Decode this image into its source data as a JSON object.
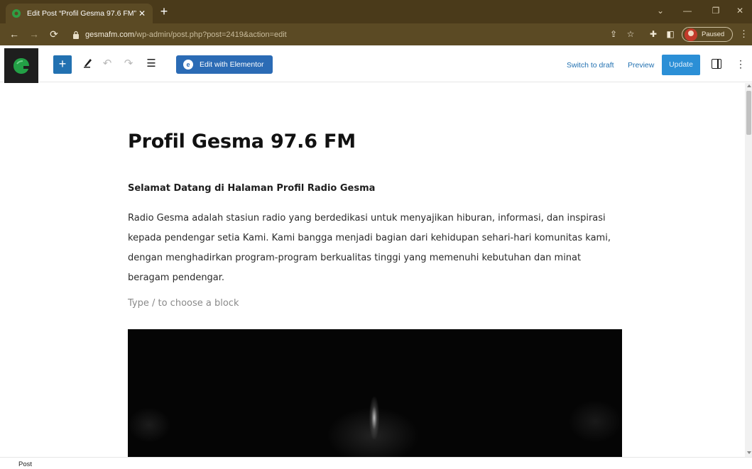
{
  "browser": {
    "tab": {
      "title": "Edit Post “Profil Gesma 97.6 FM”",
      "favicon": "gesma-favicon-icon"
    },
    "new_tab_label": "+",
    "url": {
      "host": "gesmafm.com",
      "path": "/wp-admin/post.php?post=2419&action=edit"
    },
    "profile": {
      "status": "Paused"
    },
    "window_controls": [
      "minimize-chevron",
      "minimize",
      "restore",
      "close"
    ]
  },
  "editor": {
    "header": {
      "elementor_label": "Edit with Elementor",
      "switch_to_draft_label": "Switch to draft",
      "preview_label": "Preview",
      "update_label": "Update"
    },
    "content": {
      "title": "Profil Gesma 97.6 FM",
      "heading": "Selamat Datang di Halaman Profil Radio Gesma",
      "paragraph": "Radio Gesma adalah stasiun radio yang berdedikasi untuk menyajikan hiburan, informasi, dan inspirasi kepada pendengar setia Kami. Kami bangga menjadi bagian dari kehidupan sehari-hari komunitas kami, dengan menghadirkan program-program berkualitas tinggi yang memenuhi kebutuhan dan minat beragam pendengar.",
      "block_placeholder": "Type / to choose a block"
    },
    "footer": {
      "breadcrumb": "Post"
    }
  },
  "colors": {
    "browser_frame": "#4a3a1a",
    "browser_toolbar": "#5b4a24",
    "wp_primary": "#2271b1",
    "update_button": "#2b8fd6",
    "wp_logo_bg": "#1e1e1e"
  }
}
